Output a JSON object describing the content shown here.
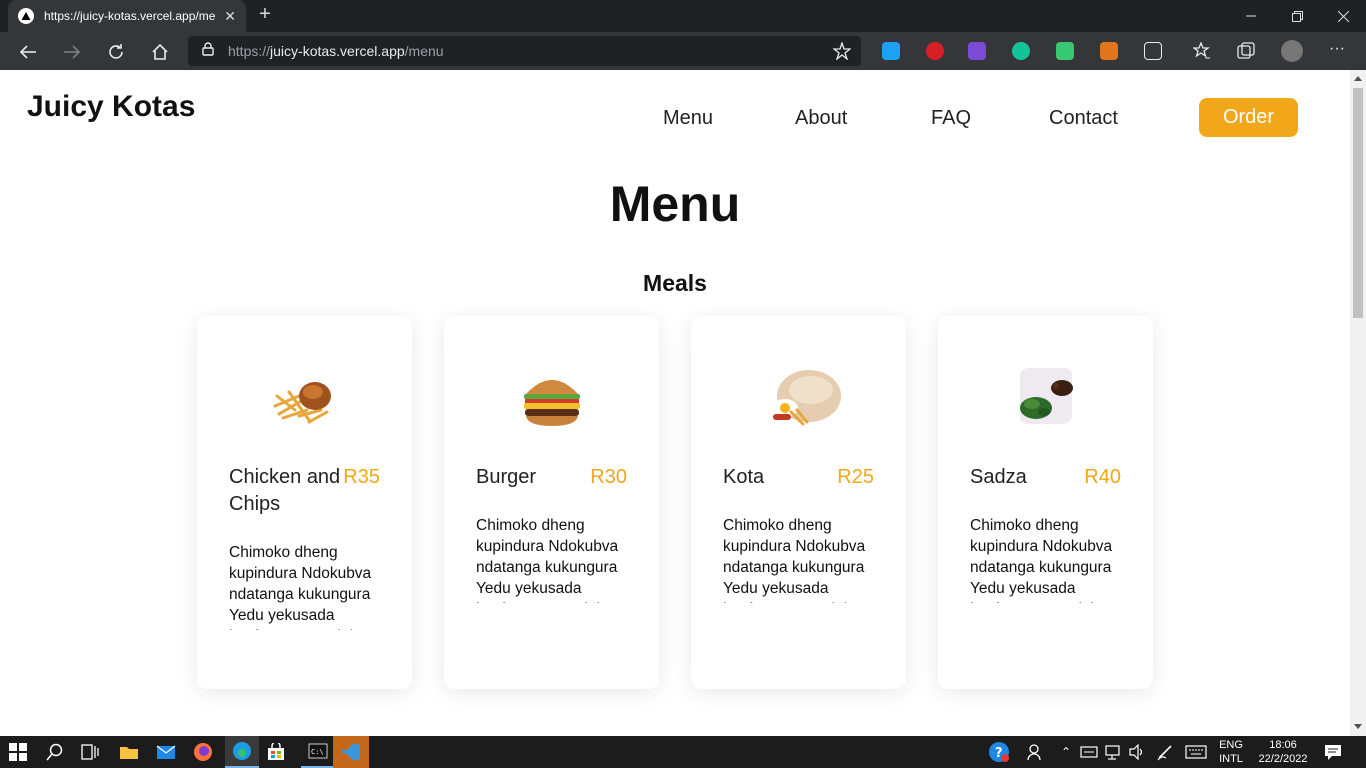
{
  "browser": {
    "tab_title": "https://juicy-kotas.vercel.app/me",
    "url_prefix": "https://",
    "url_host": "juicy-kotas.vercel.app",
    "url_path": "/menu"
  },
  "site": {
    "brand": "Juicy Kotas",
    "nav": [
      "Menu",
      "About",
      "FAQ",
      "Contact"
    ],
    "order_label": "Order"
  },
  "main": {
    "title": "Menu",
    "section_title": "Meals",
    "items": [
      {
        "name": "Chicken and Chips",
        "price": "R35",
        "description": "Chimoko dheng kupindura Ndokubva ndatanga kukungura Yedu yekusada kupfuurwa nezvinhu"
      },
      {
        "name": "Burger",
        "price": "R30",
        "description": "Chimoko dheng kupindura Ndokubva ndatanga kukungura Yedu yekusada kupfuurwa nezvinhu"
      },
      {
        "name": "Kota",
        "price": "R25",
        "description": "Chimoko dheng kupindura Ndokubva ndatanga kukungura Yedu yekusada kupfuurwa nezvinhu"
      },
      {
        "name": "Sadza",
        "price": "R40",
        "description": "Chimoko dheng kupindura Ndokubva ndatanga kukungura Yedu yekusada kupfuurwa nezvinhu"
      }
    ]
  },
  "taskbar": {
    "lang_top": "ENG",
    "lang_bottom": "INTL",
    "time": "18:06",
    "date": "22/2/2022"
  },
  "colors": {
    "accent": "#f2a71b",
    "browser_dark": "#202124",
    "browser_toolbar": "#35363a"
  }
}
